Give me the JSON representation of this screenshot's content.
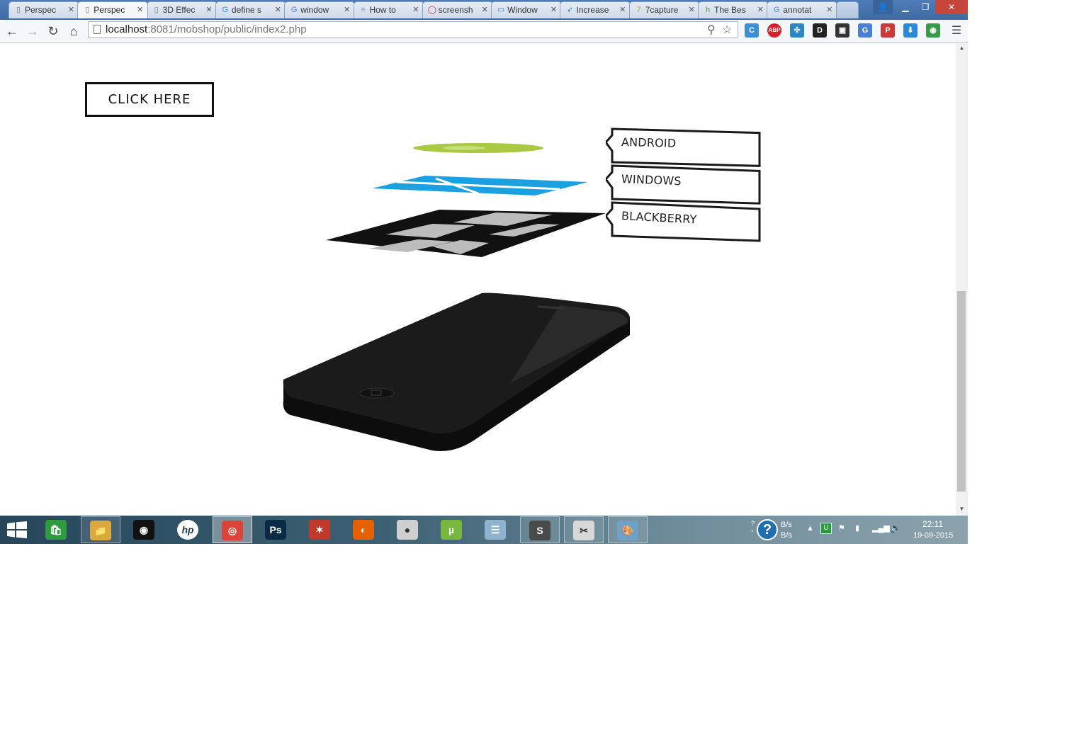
{
  "browser": {
    "tabs": [
      {
        "label": "Perspec",
        "icon": "page-icon",
        "active": false
      },
      {
        "label": "Perspec",
        "icon": "page-icon",
        "active": true
      },
      {
        "label": "3D Effec",
        "icon": "page-icon",
        "active": false
      },
      {
        "label": "define s",
        "icon": "google-icon",
        "active": false
      },
      {
        "label": "window",
        "icon": "google-icon",
        "active": false
      },
      {
        "label": "How to",
        "icon": "stackoverflow-icon",
        "active": false
      },
      {
        "label": "screensh",
        "icon": "opera-icon",
        "active": false
      },
      {
        "label": "Window",
        "icon": "window-icon",
        "active": false
      },
      {
        "label": "Increase",
        "icon": "rocket-icon",
        "active": false
      },
      {
        "label": "7capture",
        "icon": "seven-icon",
        "active": false
      },
      {
        "label": "The Bes",
        "icon": "bars-icon",
        "active": false
      },
      {
        "label": "annotat",
        "icon": "google-icon",
        "active": false
      }
    ],
    "address": {
      "host": "localhost",
      "rest": ":8081/mobshop/public/index2.php"
    },
    "extensions": [
      {
        "name": "c-extension-icon",
        "text": "C",
        "color": "#3a8fd6"
      },
      {
        "name": "adblock-plus-icon",
        "text": "ABP",
        "color": "#d9212c"
      },
      {
        "name": "network-extension-icon",
        "text": "✣",
        "color": "#2d86c4"
      },
      {
        "name": "d-extension-icon",
        "text": "D",
        "color": "#222222"
      },
      {
        "name": "screen-capture-icon",
        "text": "▣",
        "color": "#333333"
      },
      {
        "name": "translate-icon",
        "text": "G",
        "color": "#4a7fd4"
      },
      {
        "name": "pdf-extension-icon",
        "text": "P",
        "color": "#c93a3a"
      },
      {
        "name": "download-icon",
        "text": "⬇",
        "color": "#2b8ad6"
      },
      {
        "name": "chrome-extension-icon",
        "text": "◉",
        "color": "#3a9a4a"
      }
    ]
  },
  "page": {
    "cta_label": "CLICK HERE",
    "platforms": [
      {
        "label": "ANDROID",
        "color": "#a4c639"
      },
      {
        "label": "WINDOWS",
        "color": "#1ba1e2"
      },
      {
        "label": "BLACKBERRY",
        "color": "#111111"
      }
    ],
    "phone_color": "#1a1a1a"
  },
  "taskbar": {
    "apps": [
      {
        "name": "store-app",
        "icon": "store-icon",
        "glyph": "🛍",
        "color": "#2e9b3e",
        "state": "none"
      },
      {
        "name": "file-explorer-app",
        "icon": "folder-icon",
        "glyph": "📁",
        "color": "#d9a93b",
        "state": "open"
      },
      {
        "name": "webcam-app",
        "icon": "webcam-icon",
        "glyph": "◉",
        "color": "#111111",
        "state": "none"
      },
      {
        "name": "hp-app",
        "icon": "hp-icon",
        "glyph": "hp",
        "color": "#ffffff",
        "state": "none"
      },
      {
        "name": "chrome-app",
        "icon": "chrome-icon",
        "glyph": "◎",
        "color": "#db4437",
        "state": "active"
      },
      {
        "name": "photoshop-app",
        "icon": "photoshop-icon",
        "glyph": "Ps",
        "color": "#0b2a45",
        "state": "none"
      },
      {
        "name": "ccleaner-app",
        "icon": "ccleaner-icon",
        "glyph": "✶",
        "color": "#c0392b",
        "state": "none"
      },
      {
        "name": "firefox-app",
        "icon": "firefox-icon",
        "glyph": "◐",
        "color": "#e66000",
        "state": "none"
      },
      {
        "name": "camtasia-app",
        "icon": "camera-app-icon",
        "glyph": "●",
        "color": "#cfcfcf",
        "state": "none"
      },
      {
        "name": "utorrent-app",
        "icon": "utorrent-icon",
        "glyph": "µ",
        "color": "#76b83f",
        "state": "none"
      },
      {
        "name": "layers-app",
        "icon": "layers-icon",
        "glyph": "☰",
        "color": "#8fb3cf",
        "state": "none"
      },
      {
        "name": "sublime-app",
        "icon": "sublime-icon",
        "glyph": "S",
        "color": "#4a4a4a",
        "state": "open"
      },
      {
        "name": "snipping-app",
        "icon": "snipping-tool-icon",
        "glyph": "✂",
        "color": "#d8d8d8",
        "state": "open"
      },
      {
        "name": "paint-app",
        "icon": "paint-icon",
        "glyph": "🎨",
        "color": "#6fa0c8",
        "state": "open"
      }
    ],
    "net_up": "B/s",
    "net_down": "B/s",
    "time": "22:11",
    "date": "19-09-2015"
  }
}
